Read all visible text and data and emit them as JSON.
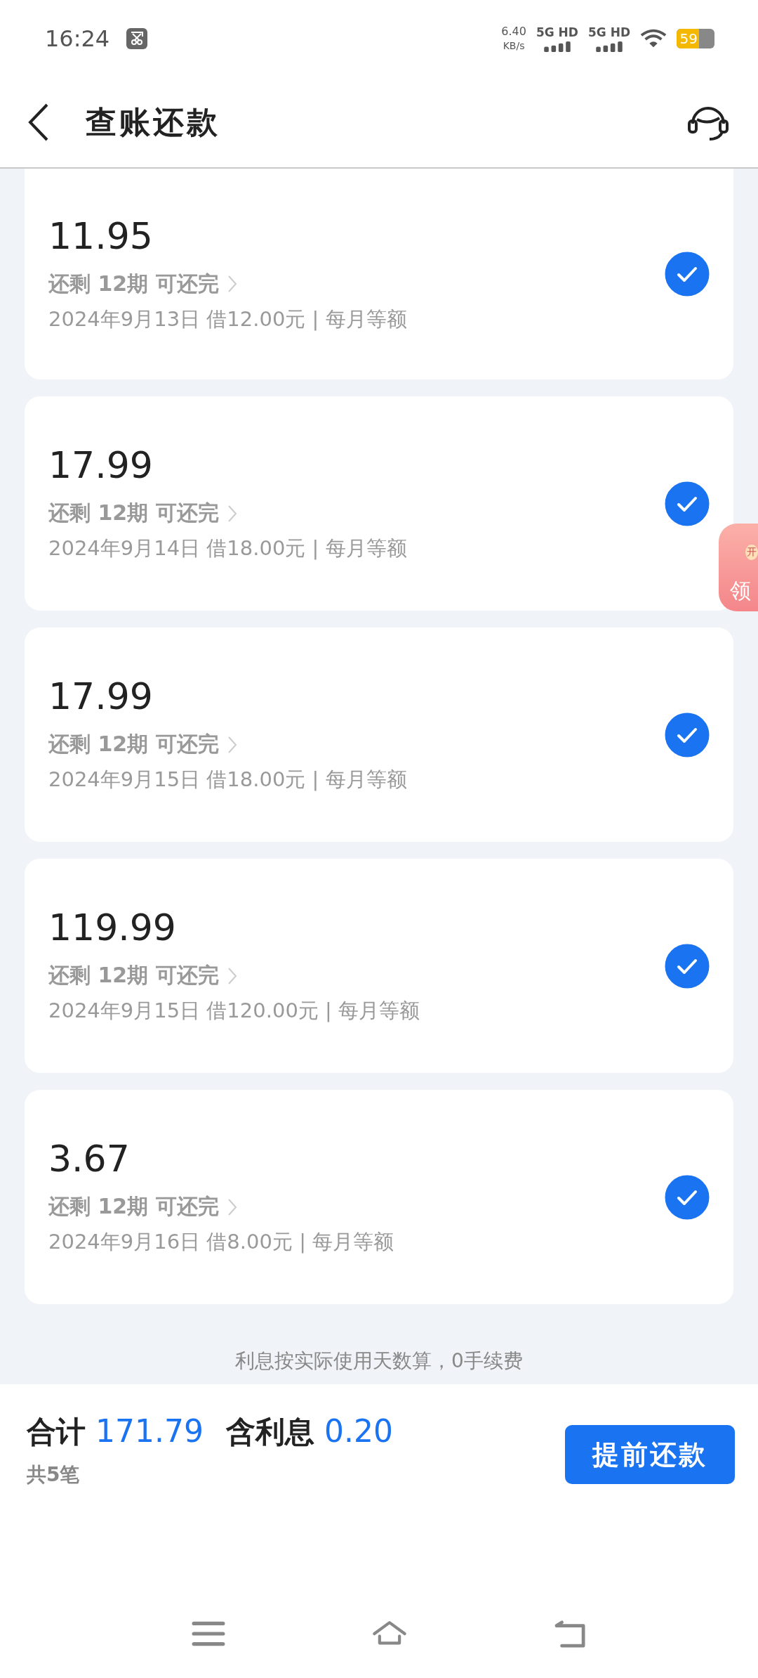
{
  "status_bar": {
    "time": "16:24",
    "net_speed": "6.40",
    "net_unit": "KB/s",
    "signals": [
      "5G HD",
      "5G HD"
    ],
    "battery": "59"
  },
  "header": {
    "title": "查账还款"
  },
  "loans": [
    {
      "amount": "11.95",
      "remaining": "还剩 12期 可还完",
      "detail": "2024年9月13日 借12.00元 | 每月等额",
      "selected": true
    },
    {
      "amount": "17.99",
      "remaining": "还剩 12期 可还完",
      "detail": "2024年9月14日 借18.00元 | 每月等额",
      "selected": true
    },
    {
      "amount": "17.99",
      "remaining": "还剩 12期 可还完",
      "detail": "2024年9月15日 借18.00元 | 每月等额",
      "selected": true
    },
    {
      "amount": "119.99",
      "remaining": "还剩 12期 可还完",
      "detail": "2024年9月15日 借120.00元 | 每月等额",
      "selected": true
    },
    {
      "amount": "3.67",
      "remaining": "还剩 12期 可还完",
      "detail": "2024年9月16日 借8.00元 | 每月等额",
      "selected": true
    }
  ],
  "floating_badge": {
    "small": "开",
    "label": "领"
  },
  "note": "利息按实际使用天数算，0手续费",
  "summary": {
    "total_label": "合计",
    "total": "171.79",
    "interest_label": "含利息",
    "interest": "0.20",
    "count": "共5笔",
    "button": "提前还款"
  }
}
